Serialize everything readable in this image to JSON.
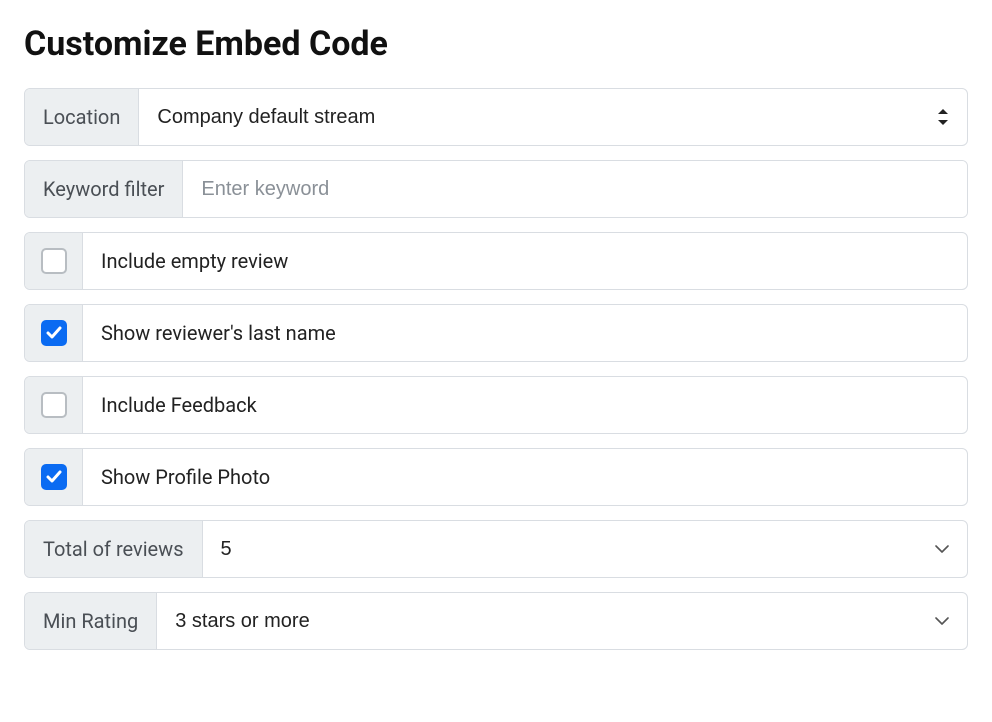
{
  "heading": "Customize Embed Code",
  "location": {
    "label": "Location",
    "value": "Company default stream"
  },
  "keywordFilter": {
    "label": "Keyword filter",
    "placeholder": "Enter keyword",
    "value": ""
  },
  "options": {
    "includeEmpty": {
      "label": "Include empty review",
      "checked": false
    },
    "showLastName": {
      "label": "Show reviewer's last name",
      "checked": true
    },
    "includeFeedback": {
      "label": "Include Feedback",
      "checked": false
    },
    "showProfilePhoto": {
      "label": "Show Profile Photo",
      "checked": true
    }
  },
  "totalReviews": {
    "label": "Total of reviews",
    "value": "5"
  },
  "minRating": {
    "label": "Min Rating",
    "value": "3 stars or more"
  }
}
